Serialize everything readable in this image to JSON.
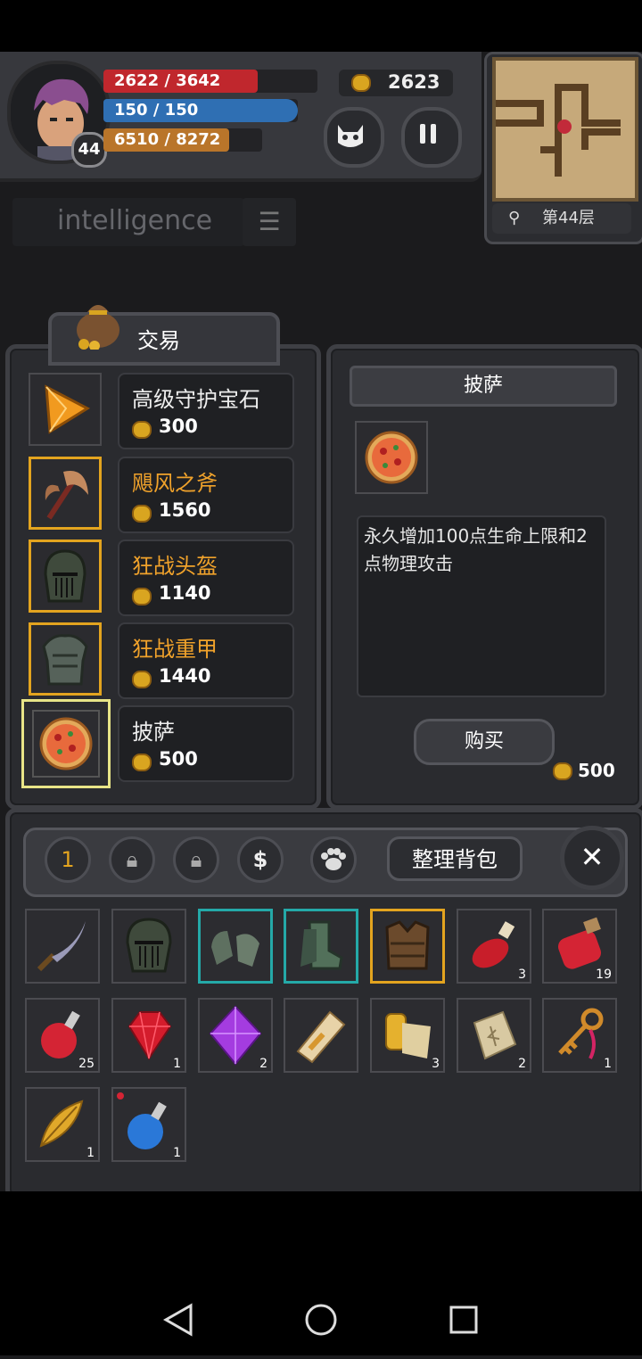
{
  "hud": {
    "hp": "2622 / 3642",
    "hp_fraction": 0.72,
    "mp": "150 / 150",
    "mp_fraction": 1.0,
    "xp": "6510 / 8272",
    "xp_fraction": 0.79,
    "level": "44",
    "gold": "2623",
    "floor": "第44层"
  },
  "search": {
    "text": "intelligence"
  },
  "trade": {
    "title": "交易",
    "items": [
      {
        "name": "高级守护宝石",
        "price": "300",
        "rarity": "white",
        "icon": "gem-arrow-icon"
      },
      {
        "name": "飓风之斧",
        "price": "1560",
        "rarity": "orange",
        "icon": "axe-icon"
      },
      {
        "name": "狂战头盔",
        "price": "1140",
        "rarity": "orange",
        "icon": "helmet-icon"
      },
      {
        "name": "狂战重甲",
        "price": "1440",
        "rarity": "orange",
        "icon": "armor-icon"
      },
      {
        "name": "披萨",
        "price": "500",
        "rarity": "white",
        "icon": "pizza-icon"
      }
    ]
  },
  "detail": {
    "title": "披萨",
    "description": "永久增加100点生命上限和2点物理攻击",
    "buy_label": "购买",
    "price": "500"
  },
  "inventory": {
    "tab1_label": "1",
    "sort_label": "整理背包",
    "currency_symbol": "$",
    "slots": [
      {
        "icon": "dagger-icon",
        "count": ""
      },
      {
        "icon": "helmet-icon",
        "count": ""
      },
      {
        "icon": "gauntlets-icon",
        "count": ""
      },
      {
        "icon": "boots-icon",
        "count": ""
      },
      {
        "icon": "vest-icon",
        "count": ""
      },
      {
        "icon": "red-potion-small-icon",
        "count": "3"
      },
      {
        "icon": "red-potion-jar-icon",
        "count": "19"
      },
      {
        "icon": "red-potion-flask-icon",
        "count": "25"
      },
      {
        "icon": "ruby-icon",
        "count": "1"
      },
      {
        "icon": "amethyst-icon",
        "count": "2"
      },
      {
        "icon": "scroll-icon",
        "count": ""
      },
      {
        "icon": "map-scroll-icon",
        "count": "3"
      },
      {
        "icon": "rune-stone-icon",
        "count": "2"
      },
      {
        "icon": "key-icon",
        "count": "1"
      },
      {
        "icon": "feather-icon",
        "count": "1"
      },
      {
        "icon": "blue-potion-icon",
        "count": "1"
      }
    ]
  },
  "colors": {
    "hp": "#c0272d",
    "mp": "#2f6fb3",
    "xp": "#b9752a",
    "rare_orange": "#f0a22b",
    "epic_teal": "#24a9a8",
    "selected": "#e8e487"
  }
}
